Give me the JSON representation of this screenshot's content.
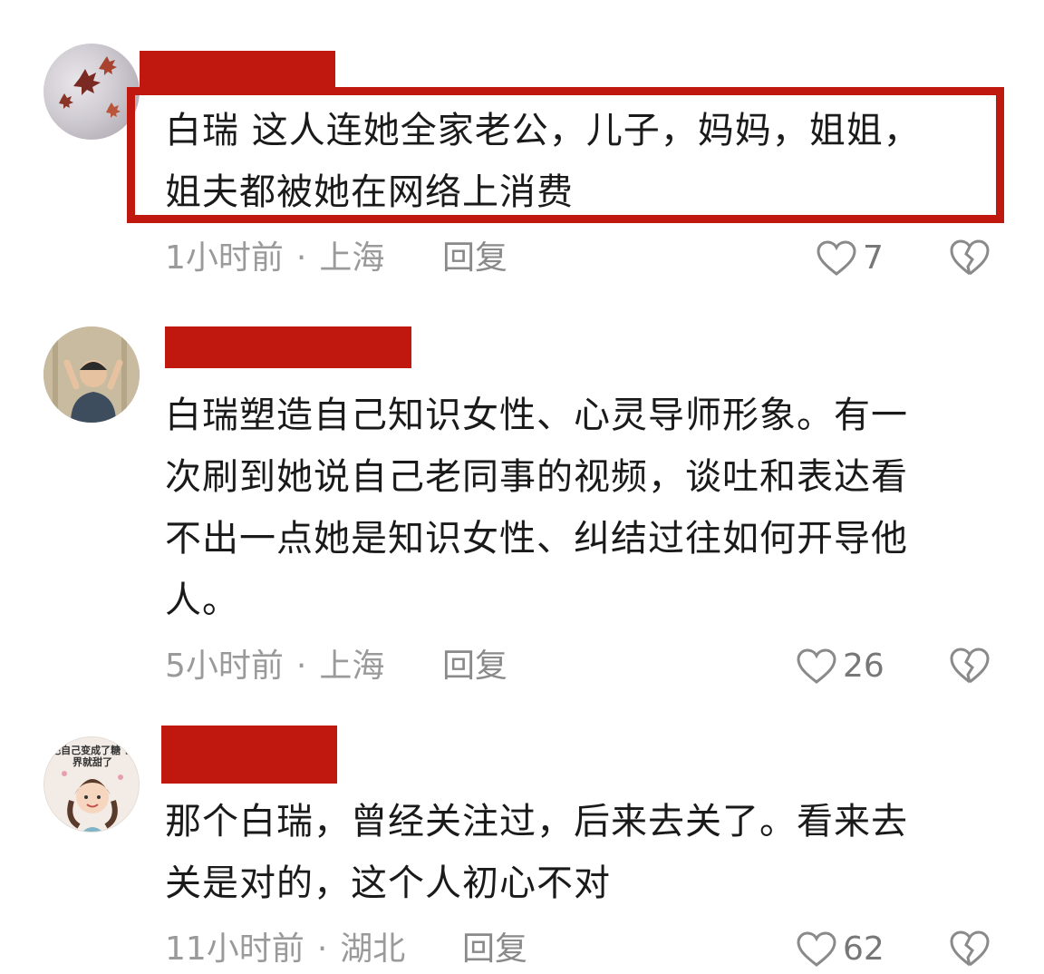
{
  "comments": [
    {
      "text_lines": [
        "白瑞 这人连她全家老公，儿子，妈妈，姐姐，",
        "姐夫都被她在网络上消费"
      ],
      "time": "1小时前",
      "location": "上海",
      "reply_label": "回复",
      "likes": "7",
      "avatar_colors": [
        "#6b3b3b",
        "#c9c7cc"
      ]
    },
    {
      "text_lines": [
        "白瑞塑造自己知识女性、心灵导师形象。有一",
        "次刷到她说自己老同事的视频，谈吐和表达看",
        "不出一点她是知识女性、纠结过往如何开导他",
        "人。"
      ],
      "time": "5小时前",
      "location": "上海",
      "reply_label": "回复",
      "likes": "26",
      "avatar_colors": [
        "#b9a88a",
        "#3b4a5a"
      ]
    },
    {
      "text_lines": [
        "那个白瑞，曾经关注过，后来去关了。看来去",
        "关是对的，这个人初心不对"
      ],
      "time": "11小时前",
      "location": "湖北",
      "reply_label": "回复",
      "likes": "62",
      "avatar_caption": "把自己变成了糖 世界就甜了",
      "avatar_colors": [
        "#f3ece6",
        "#5a3a2a"
      ]
    }
  ],
  "separator": "·",
  "highlight_color": "#c0170f",
  "icons": {
    "like": "heart-outline-icon",
    "dislike": "broken-heart-icon"
  }
}
